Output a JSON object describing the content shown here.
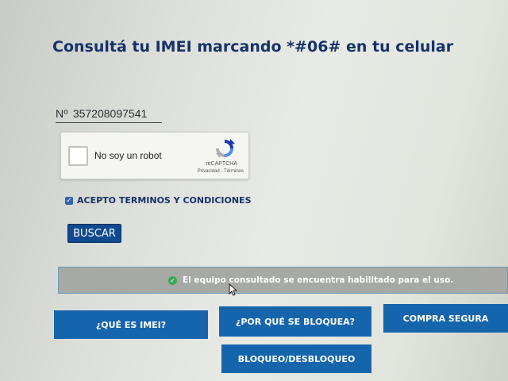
{
  "page": {
    "title": "Consultá tu IMEI marcando *#06# en tu celular"
  },
  "imei": {
    "prefix": "Nº",
    "value": "357208097541"
  },
  "captcha": {
    "label": "No soy un robot",
    "brand": "reCAPTCHA",
    "links": "Privacidad - Términos"
  },
  "terms": {
    "checked": true,
    "label": "ACEPTO TERMINOS Y CONDICIONES"
  },
  "search": {
    "button_label": "BUSCAR"
  },
  "status": {
    "message": "El equipo consultado se encuentra habilitado para el uso.",
    "icon": "check-circle-icon",
    "color": "#3aa957"
  },
  "nav": {
    "what_is_imei": "¿QUÉ ES IMEI?",
    "why_blocked": "¿POR QUÉ SE BLOQUEA?",
    "safe_purchase": "COMPRA SEGURA",
    "block_unblock": "BLOQUEO/DESBLOQUEO"
  },
  "colors": {
    "title": "#16326a",
    "button": "#1565ac",
    "search_button": "#0f4a8e",
    "status_bar": "#a7aaa4"
  }
}
